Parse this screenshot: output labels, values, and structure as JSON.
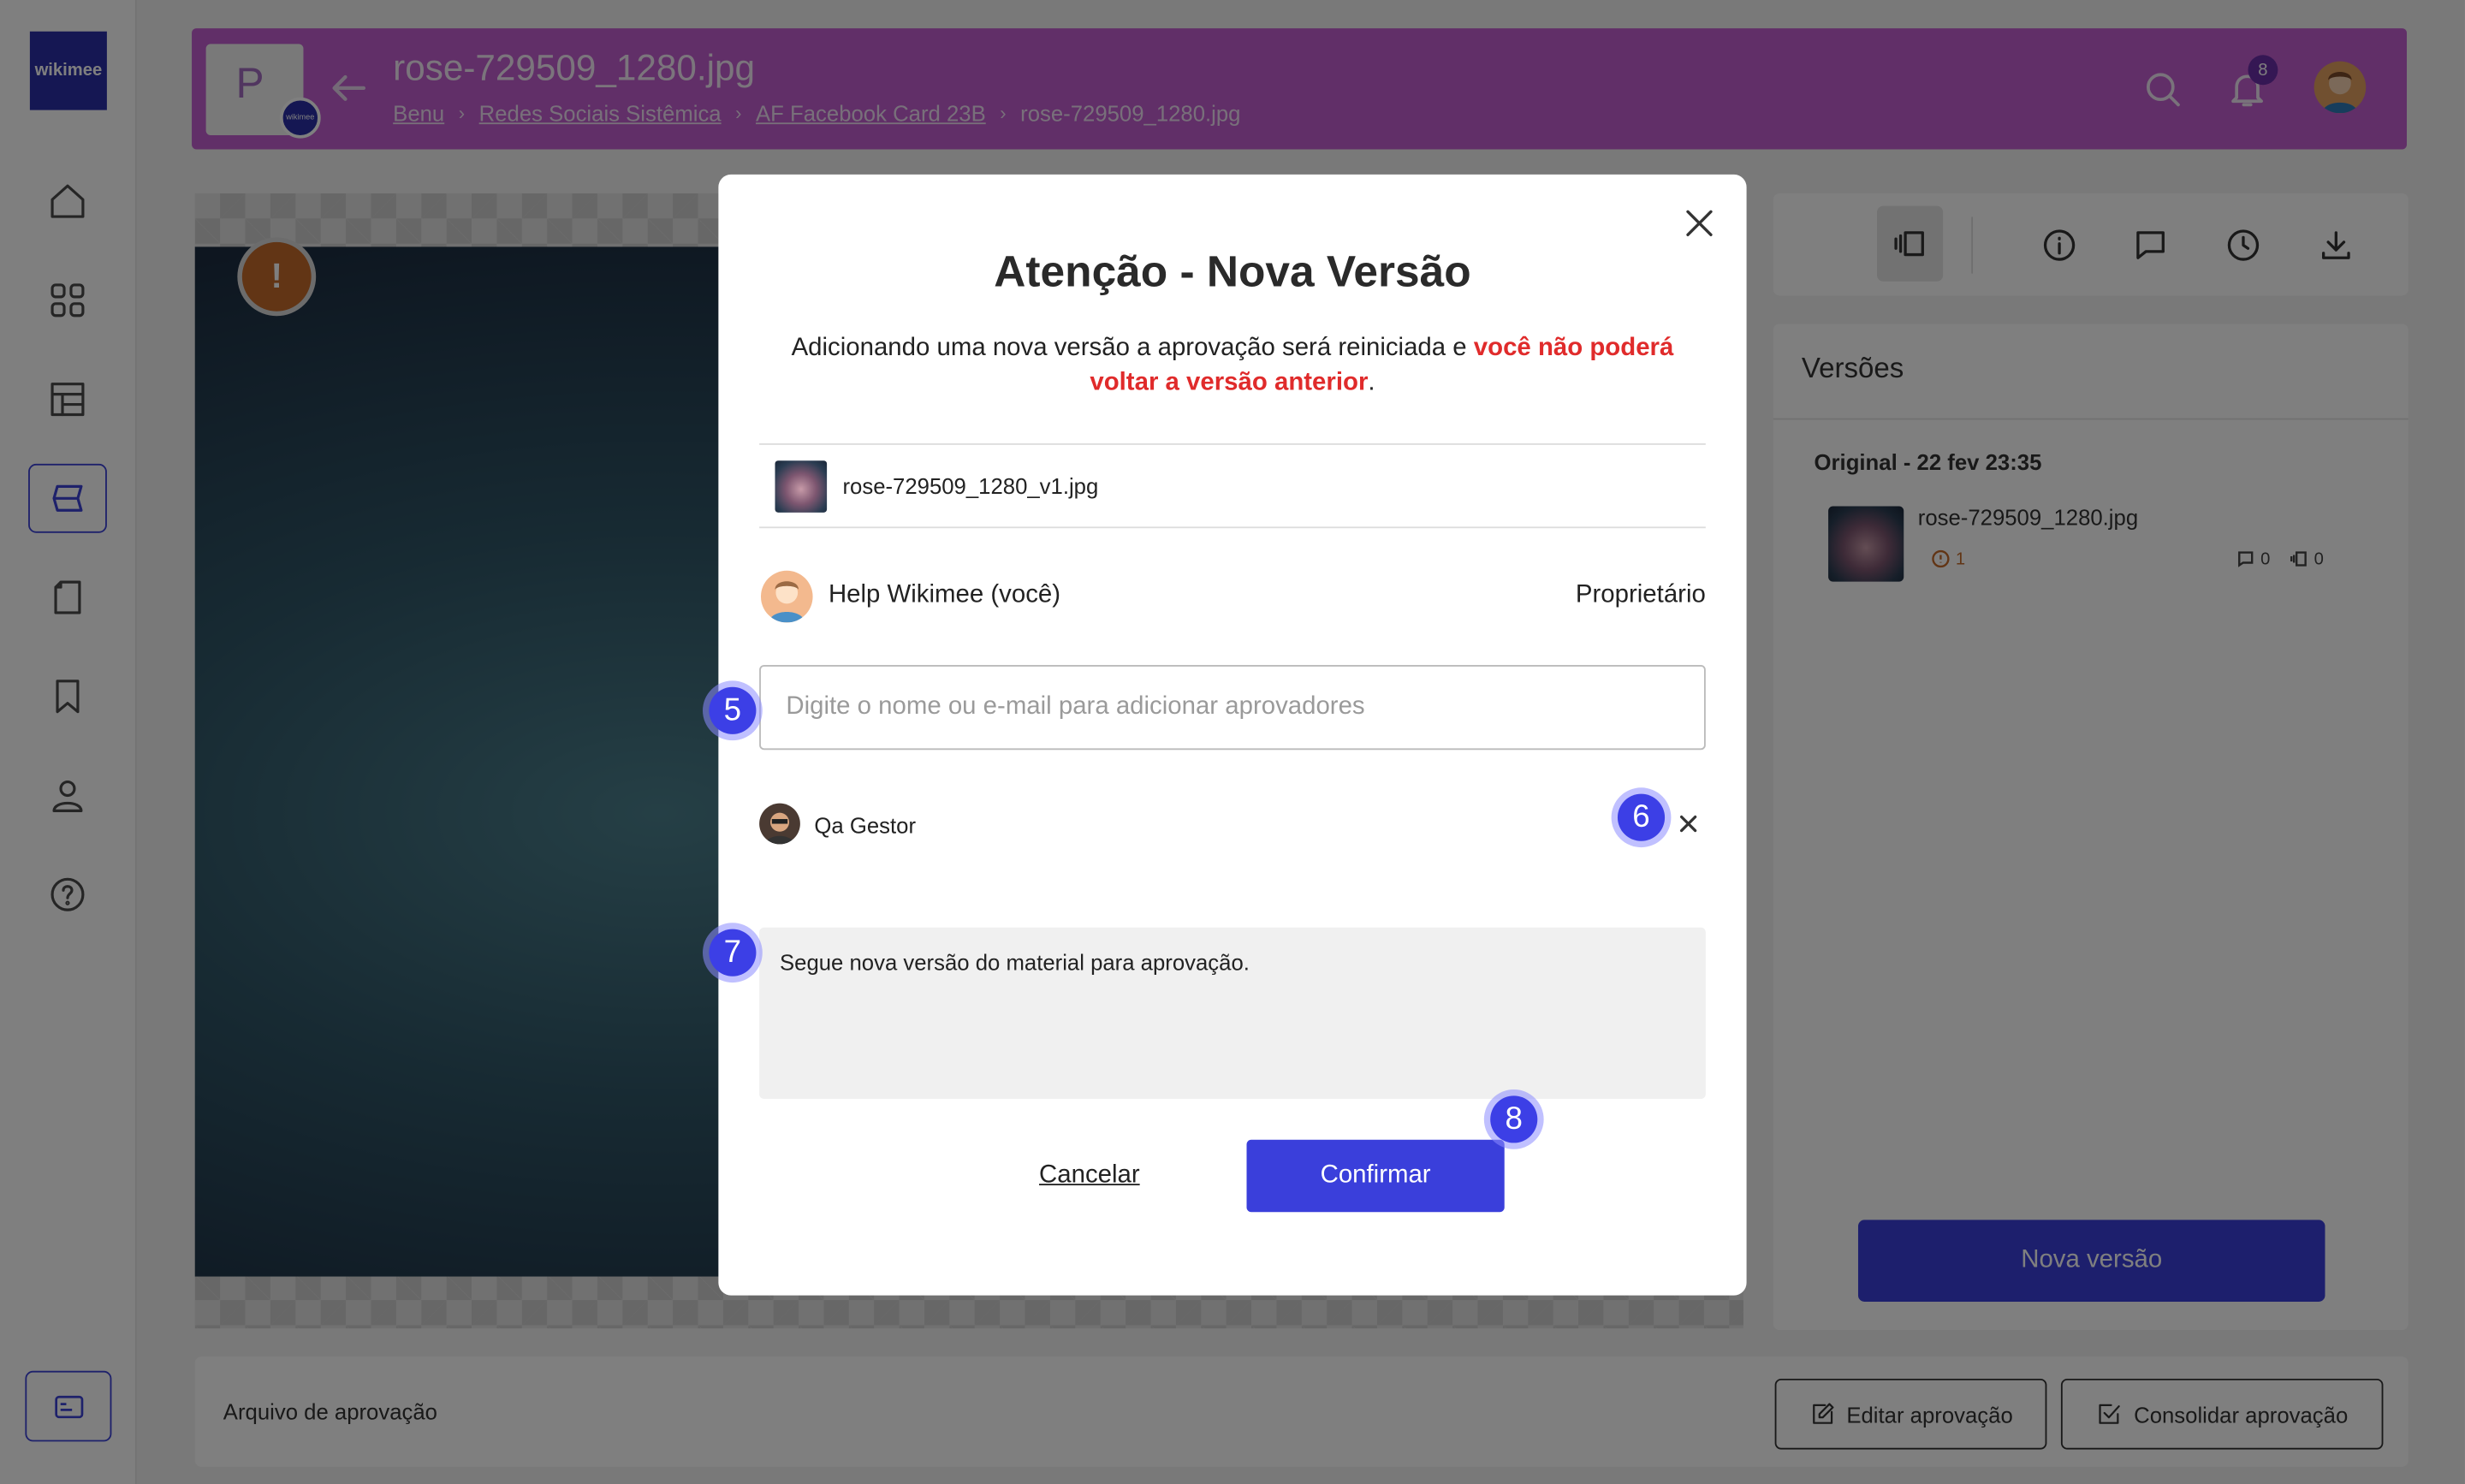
{
  "app": {
    "logo_text": "wikimee"
  },
  "sidebar": {
    "items": [
      {
        "name": "home-icon"
      },
      {
        "name": "grid-icon"
      },
      {
        "name": "layout-icon"
      },
      {
        "name": "approvals-icon",
        "active": true
      },
      {
        "name": "document-icon"
      },
      {
        "name": "bookmark-icon"
      },
      {
        "name": "user-icon"
      },
      {
        "name": "help-icon"
      }
    ],
    "bottom_icon": "card-icon"
  },
  "header": {
    "project_letter": "P",
    "badge_text": "wikimee",
    "title": "rose-729509_1280.jpg",
    "breadcrumb": [
      "Benu",
      "Redes Sociais Sistêmica",
      "AF Facebook Card 23B",
      "rose-729509_1280.jpg"
    ],
    "breadcrumb_separator": "›",
    "notification_count": "8",
    "color": "#c25ed0"
  },
  "preview": {
    "warning_symbol": "!"
  },
  "versions": {
    "title": "Versões",
    "original_label": "Original - 22 fev 23:35",
    "file_name": "rose-729509_1280.jpg",
    "alerts": "1",
    "comments": "0",
    "versions_count": "0",
    "new_version_button": "Nova versão"
  },
  "bottom_bar": {
    "label": "Arquivo de aprovação",
    "edit_button": "Editar aprovação",
    "consolidate_button": "Consolidar aprovação"
  },
  "modal": {
    "title": "Atenção - Nova Versão",
    "warning_text": "Adicionando uma nova versão a aprovação será reiniciada e ",
    "warning_highlight": "você não poderá voltar a versão anterior",
    "warning_end": ".",
    "file_name": "rose-729509_1280_v1.jpg",
    "owner_name": "Help Wikimee (você)",
    "owner_role": "Proprietário",
    "approver_placeholder": "Digite o nome ou e-mail para adicionar aprovadores",
    "approver_name": "Qa Gestor",
    "message": "Segue nova versão do material para aprovação.",
    "cancel_label": "Cancelar",
    "confirm_label": "Confirmar"
  },
  "step_markers": [
    "5",
    "6",
    "7",
    "8"
  ],
  "colors": {
    "accent": "#3a3fdb",
    "warning_red": "#e02b2b",
    "header_purple": "#c25ed0"
  }
}
